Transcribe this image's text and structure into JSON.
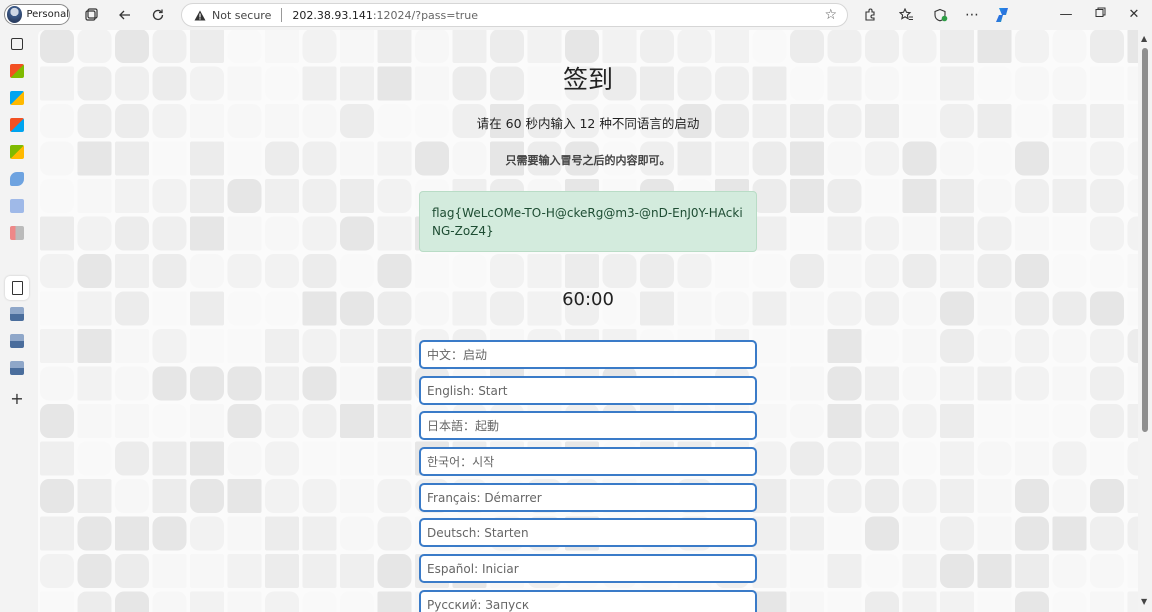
{
  "browser": {
    "profile_label": "Personal",
    "security_label": "Not secure",
    "url_host": "202.38.93.141",
    "url_path": ":12024/?pass=true",
    "icons": [
      "tabs-icon",
      "back-icon",
      "refresh-icon",
      "favorite-star-icon",
      "extensions-icon",
      "favorites-icon",
      "browser-essentials-icon",
      "more-icon",
      "copilot-icon",
      "minimize-icon",
      "maximize-icon",
      "close-icon"
    ]
  },
  "page": {
    "title": "签到",
    "subtitle": "请在 60 秒内输入 12 种不同语言的启动",
    "hint": "只需要输入冒号之后的内容即可。",
    "flag": "flag{WeLcOMe-TO-H@ckeRg@m3-@nD-EnJ0Y-HAckiNG-ZoZ4}",
    "timer": "60:00",
    "inputs": [
      {
        "placeholder": "中文：启动"
      },
      {
        "placeholder": "English: Start"
      },
      {
        "placeholder": "日本語：起動"
      },
      {
        "placeholder": "한국어：시작"
      },
      {
        "placeholder": "Français: Démarrer"
      },
      {
        "placeholder": "Deutsch: Starten"
      },
      {
        "placeholder": "Español: Iniciar"
      },
      {
        "placeholder": "Русский: Запуск"
      }
    ]
  },
  "colors": {
    "accent": "#3a7bc8",
    "flag_bg": "#d3ebdd",
    "flag_text": "#1e4d33"
  }
}
